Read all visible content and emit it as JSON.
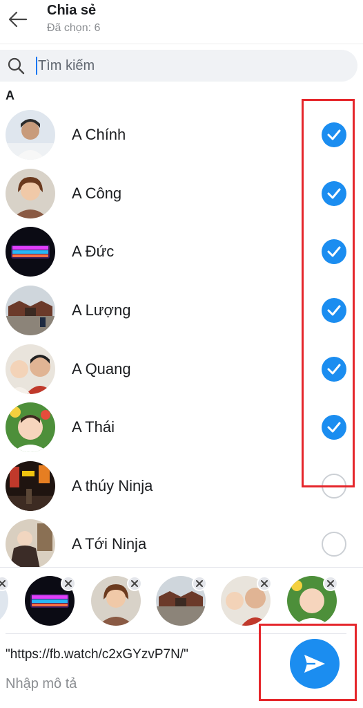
{
  "header": {
    "title": "Chia sẻ",
    "subtitle": "Đã chọn: 6"
  },
  "search": {
    "placeholder": "Tìm kiếm",
    "value": ""
  },
  "section_letter": "A",
  "contacts": [
    {
      "name": "A Chính",
      "selected": true,
      "avatar": "man-white-shirt-photo"
    },
    {
      "name": "A Công",
      "selected": true,
      "avatar": "woman-selfie-photo"
    },
    {
      "name": "A Đức",
      "selected": true,
      "avatar": "rgb-keyboard-photo"
    },
    {
      "name": "A Lượng",
      "selected": true,
      "avatar": "pagoda-gate-photo"
    },
    {
      "name": "A Quang",
      "selected": true,
      "avatar": "father-and-baby-photo"
    },
    {
      "name": "A Thái",
      "selected": true,
      "avatar": "smiling-baby-photo"
    },
    {
      "name": "A thúy Ninja",
      "selected": false,
      "avatar": "night-street-photo"
    },
    {
      "name": "A Tới Ninja",
      "selected": false,
      "avatar": "person-in-coat-photo"
    }
  ],
  "composer": {
    "link": "\"https://fb.watch/c2xGYzvP7N/\"",
    "description_placeholder": "Nhập mô tả"
  },
  "colors": {
    "accent": "#1b8df0",
    "annotation": "#e5262b"
  },
  "icons": {
    "back": "arrow-left-icon",
    "search": "magnifier-icon",
    "selected": "check-circle-icon",
    "remove": "close-icon",
    "send": "paper-plane-icon"
  }
}
